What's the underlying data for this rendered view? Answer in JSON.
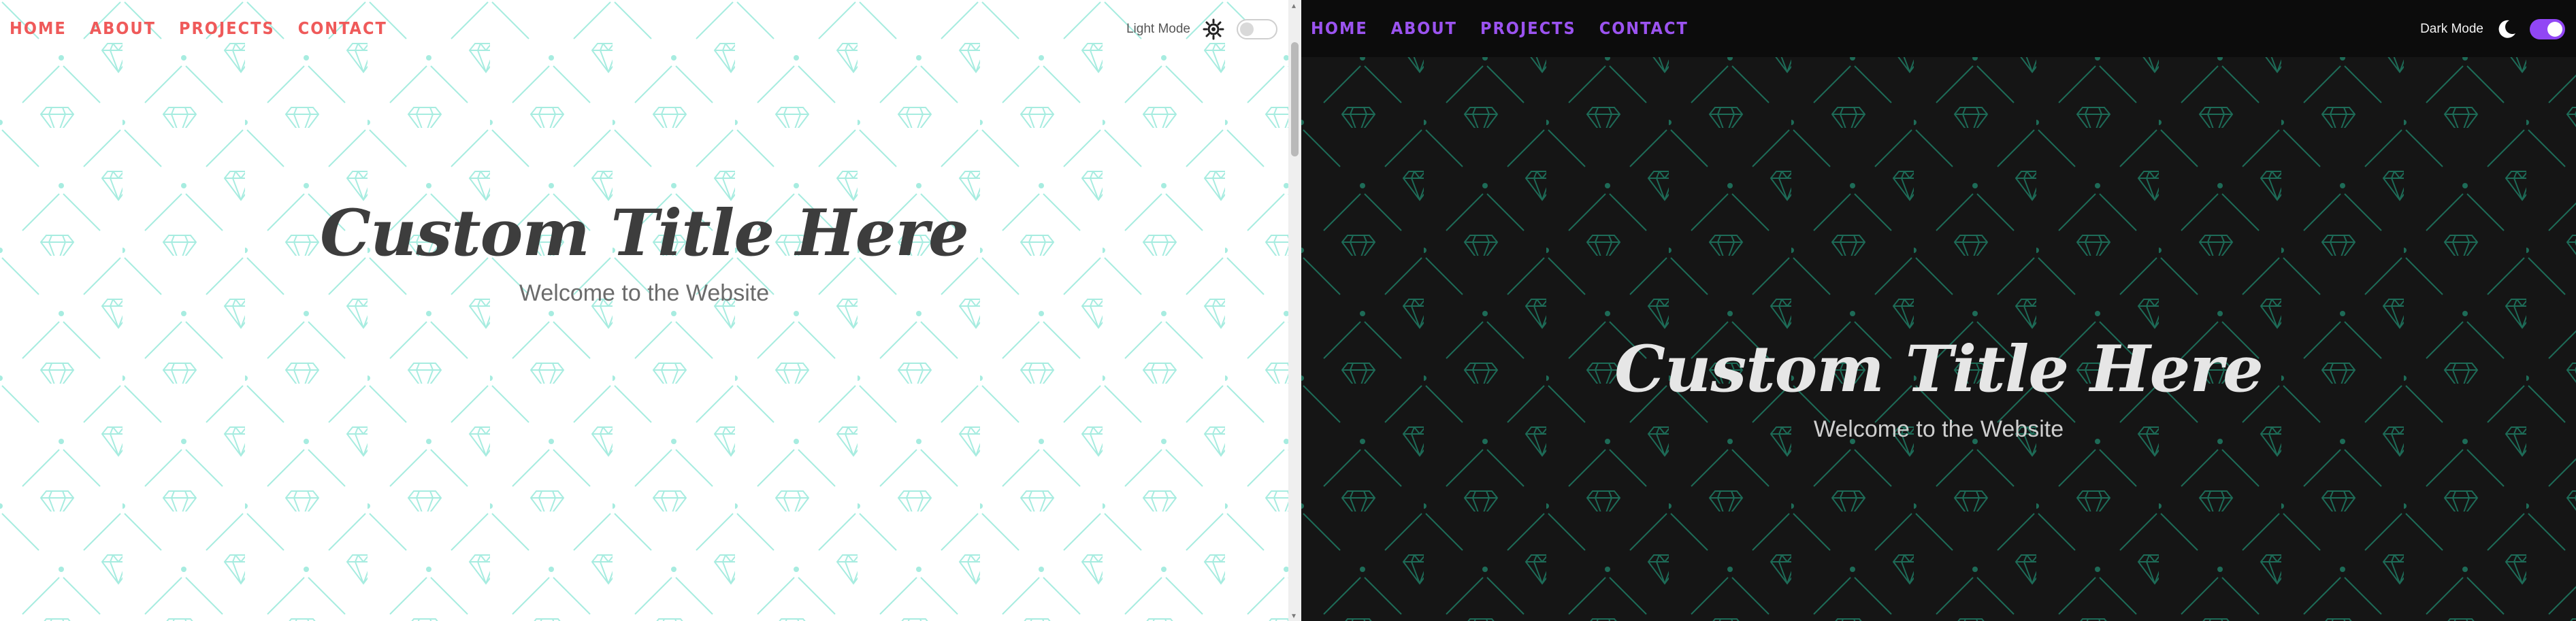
{
  "nav": {
    "home": "HOME",
    "about": "ABOUT",
    "projects": "PROJECTS",
    "contact": "CONTACT"
  },
  "hero": {
    "title": "Custom Title Here",
    "subtitle": "Welcome to the Website"
  },
  "light_panel": {
    "mode_label": "Light Mode",
    "mode_icon": "sun-icon",
    "toggle_on": false
  },
  "dark_panel": {
    "mode_label": "Dark Mode",
    "mode_icon": "moon-icon",
    "toggle_on": true
  },
  "colors": {
    "light_nav_accent": "#ef5a5a",
    "dark_nav_accent": "#9b53f0",
    "dark_toggle_on": "#9146f5",
    "light_pattern": "#9ee9dc",
    "dark_pattern": "#1f6f5a",
    "dark_background": "#151515"
  }
}
